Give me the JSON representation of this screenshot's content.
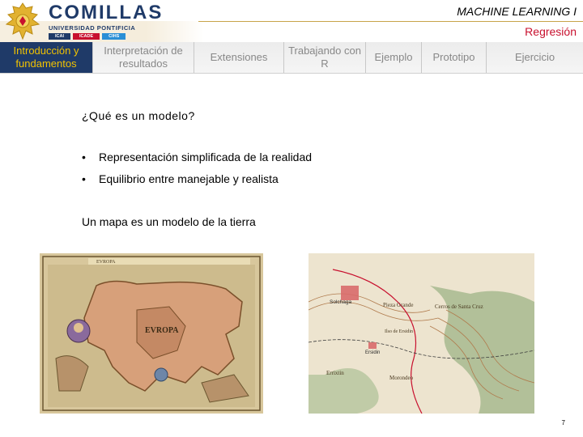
{
  "header": {
    "brand_name": "COMILLAS",
    "brand_subtitle": "UNIVERSIDAD PONTIFICIA",
    "brand_tags": [
      "ICAI",
      "ICADE",
      "CIHS"
    ],
    "course_title": "MACHINE LEARNING I",
    "section_title": "Regresión"
  },
  "nav": {
    "items": [
      {
        "label": "Introducción y fundamentos",
        "active": true
      },
      {
        "label": "Interpretación de resultados",
        "active": false
      },
      {
        "label": "Extensiones",
        "active": false
      },
      {
        "label": "Trabajando con R",
        "active": false
      },
      {
        "label": "Ejemplo",
        "active": false
      },
      {
        "label": "Prototipo",
        "active": false
      },
      {
        "label": "Ejercicio",
        "active": false
      }
    ]
  },
  "slide": {
    "question": "¿Qué es un modelo?",
    "bullets": [
      "Representación simplificada de la realidad",
      "Equilibrio entre manejable y realista"
    ],
    "map_caption": "Un mapa es un modelo de la tierra",
    "page_number": "7"
  },
  "images": {
    "europe_map": {
      "title": "EVROPA",
      "region_label": "EVROPA"
    },
    "topo_map": {
      "labels": [
        "Solchaga",
        "Pieza Grande",
        "Cerros de Santa Cruz",
        "Ilso de Ersidin",
        "Ersidin",
        "Errixtin",
        "Morondeo"
      ]
    }
  },
  "colors": {
    "brand_blue": "#1f3a68",
    "nav_active_text": "#f2c300",
    "section_red": "#c8102e",
    "accent_gold": "#c8a44a"
  }
}
